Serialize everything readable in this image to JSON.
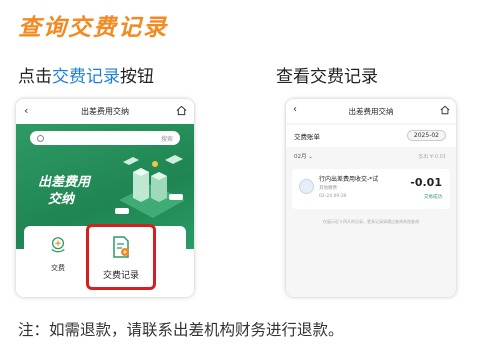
{
  "title": "查询交费记录",
  "captions": {
    "left_prefix": "点击",
    "left_highlight": "交费记录",
    "left_suffix": "按钮",
    "right": "查看交费记录"
  },
  "left_phone": {
    "header_title": "出差费用交纳",
    "search_placeholder": "搜索",
    "slogan_line1": "出差费用",
    "slogan_line2": "交纳",
    "pay_label": "交费",
    "records_label": "交费记录"
  },
  "right_phone": {
    "header_title": "出差费用交纳",
    "bill_title": "交费账单",
    "year_select": "2025-02",
    "month_select": "02月",
    "summary": "支出 ¥-0.01",
    "item": {
      "name": "行内出差费用收交-*试",
      "category": "其他缴费",
      "datetime": "02-24 09:39",
      "amount": "-0.01",
      "status": "交易成功"
    },
    "hint": "仅展示近十四天的记录，更多记录请通过查询系统查询"
  },
  "colors": {
    "title": "#f28b22",
    "highlight_text": "#1e7fd8",
    "banner_green": "#1f8552",
    "highlight_border": "#d4211f"
  },
  "note": "注：如需退款，请联系出差机构财务进行退款。"
}
